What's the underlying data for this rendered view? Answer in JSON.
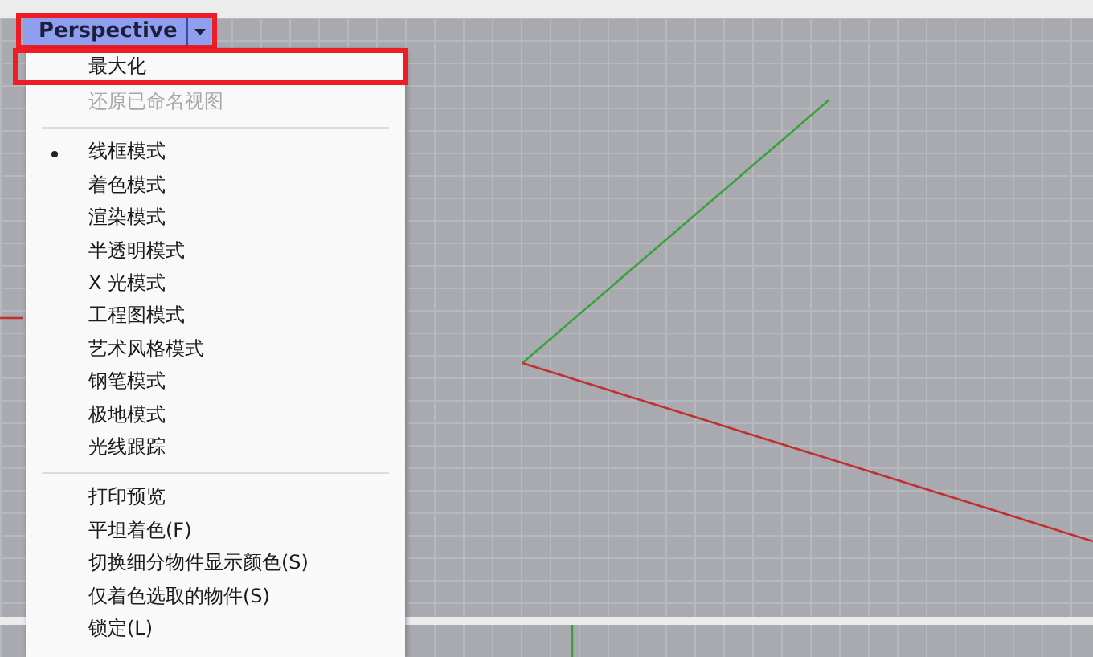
{
  "viewport": {
    "tab": {
      "title": "Perspective",
      "highlighted": true
    }
  },
  "menu": {
    "items": [
      {
        "kind": "item",
        "label": "最大化",
        "disabled": false,
        "checked": false,
        "highlighted": true
      },
      {
        "kind": "item",
        "label": "还原已命名视图",
        "disabled": true,
        "checked": false,
        "highlighted": false
      },
      {
        "kind": "separator"
      },
      {
        "kind": "item",
        "label": "线框模式",
        "disabled": false,
        "checked": true,
        "highlighted": false
      },
      {
        "kind": "item",
        "label": "着色模式",
        "disabled": false,
        "checked": false,
        "highlighted": false
      },
      {
        "kind": "item",
        "label": "渲染模式",
        "disabled": false,
        "checked": false,
        "highlighted": false
      },
      {
        "kind": "item",
        "label": "半透明模式",
        "disabled": false,
        "checked": false,
        "highlighted": false
      },
      {
        "kind": "item",
        "label": "X 光模式",
        "disabled": false,
        "checked": false,
        "highlighted": false
      },
      {
        "kind": "item",
        "label": "工程图模式",
        "disabled": false,
        "checked": false,
        "highlighted": false
      },
      {
        "kind": "item",
        "label": "艺术风格模式",
        "disabled": false,
        "checked": false,
        "highlighted": false
      },
      {
        "kind": "item",
        "label": "钢笔模式",
        "disabled": false,
        "checked": false,
        "highlighted": false
      },
      {
        "kind": "item",
        "label": "极地模式",
        "disabled": false,
        "checked": false,
        "highlighted": false
      },
      {
        "kind": "item",
        "label": "光线跟踪",
        "disabled": false,
        "checked": false,
        "highlighted": false
      },
      {
        "kind": "separator"
      },
      {
        "kind": "item",
        "label": "打印预览",
        "disabled": false,
        "checked": false,
        "highlighted": false
      },
      {
        "kind": "item",
        "label": "平坦着色(F)",
        "disabled": false,
        "checked": false,
        "highlighted": false
      },
      {
        "kind": "item",
        "label": "切换细分物件显示颜色(S)",
        "disabled": false,
        "checked": false,
        "highlighted": false
      },
      {
        "kind": "item",
        "label": "仅着色选取的物件(S)",
        "disabled": false,
        "checked": false,
        "highlighted": false
      },
      {
        "kind": "item",
        "label": "锁定(L)",
        "disabled": false,
        "checked": false,
        "highlighted": false
      }
    ]
  }
}
